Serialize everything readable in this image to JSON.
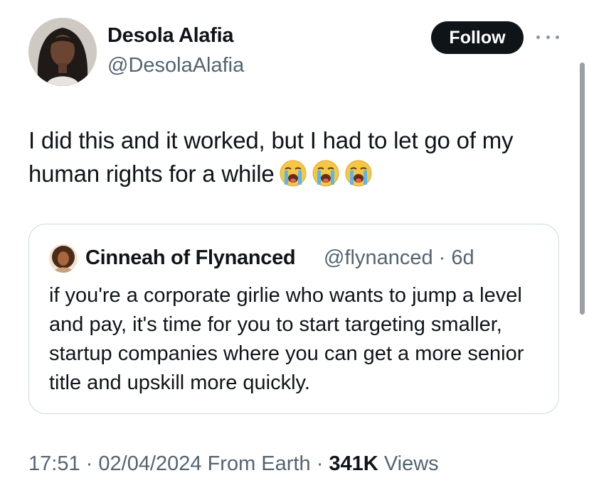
{
  "tweet": {
    "author_name": "Desola Alafia",
    "author_handle": "@DesolaAlafia",
    "follow_label": "Follow",
    "text": "I did this and it worked, but I had to let go of my human rights for a while",
    "emoji": "loudly-crying-face",
    "emoji_count": 3
  },
  "quote": {
    "author_name": "Cinneah of Flynanced",
    "author_handle": "@flynanced",
    "separator": "·",
    "age": "6d",
    "text": "if you're a corporate girlie who wants to jump a level and pay, it's time for you to start targeting smaller, startup companies where you can get a more senior title and upskill more quickly."
  },
  "footer": {
    "time": "17:51",
    "separator": "·",
    "date": "02/04/2024",
    "source": "From Earth",
    "views_count": "341K",
    "views_label": "Views"
  },
  "colors": {
    "text": "#0f1419",
    "secondary_text": "#536471",
    "border": "#cfd9de",
    "follow_background": "#0f1419"
  },
  "icons": {
    "more": "more-horizontal-icon"
  }
}
